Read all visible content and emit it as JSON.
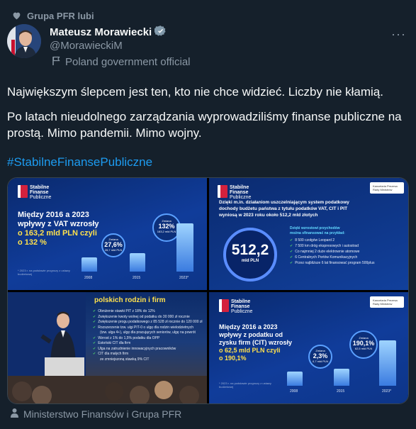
{
  "social_context": "Grupa PFR lubi",
  "author": {
    "name": "Mateusz Morawiecki",
    "handle": "@MorawieckiM",
    "affiliation": "Poland government official"
  },
  "tweet": {
    "line1": "Największym ślepcem jest ten, kto nie chce widzieć. Liczby nie kłamią.",
    "line2": "Po latach nieudolnego zarządzania wyprowadziliśmy finanse publiczne na prostą. Mimo pandemii. Mimo wojny.",
    "hashtag": "#StabilneFinansePubliczne"
  },
  "media": {
    "logo": [
      "Stabilne",
      "Finanse",
      "Publiczne"
    ],
    "kprm": "Kancelaria Prezesa Rady Ministrów",
    "panel1": {
      "heading_a": "Między 2016 a 2023",
      "heading_b": "wpływy z VAT wzrosły",
      "heading_c": "o 163,2 mld PLN czyli",
      "heading_d": "o 132 %",
      "bubble1_cap": "Zmiana",
      "bubble1_val": "27,6%",
      "bubble1_sub": "26,7 mld PLN",
      "bubble2_cap": "Zmiana",
      "bubble2_val": "132%",
      "bubble2_sub": "163,2 mld PLN",
      "years": [
        "2008",
        "2015",
        "2023*"
      ],
      "footnote": "* 2023 r. na podstawie prognozy z ustawy budżetowej"
    },
    "panel2": {
      "intro1": "Dzięki m.in. działaniom uszczelniającym system podatkowy",
      "intro2": "dochody budżetu państwa z tytułu podatków VAT, CIT i PIT",
      "intro3": "wyniosą w 2023 roku około 512,2 mld złotych",
      "circle_value": "512,2",
      "circle_unit": "mld PLN",
      "list_head1": "Dzięki wzrostowi przychodów",
      "list_head2": "można sfinansować na przykład:",
      "items": [
        "8 500 czołgów Leopard 2",
        "7 500 km dróg ekspresowych i autostrad",
        "Co najmniej 2 duże elektrownie atomowe",
        "6 Centralnych Portów Komunikacyjnych",
        "Przez najbliższe 6 lat finansować program 500plus"
      ]
    },
    "panel3": {
      "heading": "polskich rodzin i firm",
      "items": [
        "Obniżenie stawki PIT z 18% do 12%",
        "Zwiększenie kwoty wolnej od podatku do 30 000 zł rocznie",
        "Zwiększenie progu podatkowego z 85 528 zł rocznie do 120 000 zł",
        "Rozszerzenie tzw. ulgi PIT-0 o ulgę dla rodzin wielodzietnych",
        "(tzw. ulga 4+), ulgę dla pracujących seniorów, ulgę na powrót",
        "Wzrost z 1% do 1,5% podatku dla OPP",
        "Estoński CIT dla firm",
        "Ulga na zatrudnienie innowacyjnych pracowników",
        "CIT dla małych firm",
        "ze zmniejszoną stawką 9% CIT"
      ]
    },
    "panel4": {
      "heading_a": "Między 2016 a 2023",
      "heading_b": "wpływy z podatku od",
      "heading_c": "zysku firm (CIT) wzrosły",
      "heading_d": "o 62,5 mld PLN czyli",
      "heading_e": "o 190,1%",
      "bubble1_cap": "Zmiana",
      "bubble1_val": "2,3%",
      "bubble1_sub": "0,7 mld PLN",
      "bubble2_cap": "Zmiana",
      "bubble2_val": "190,1%",
      "bubble2_sub": "62,5 mld PLN",
      "years": [
        "2008",
        "2015",
        "2023*"
      ],
      "footnote": "* 2023 r. na podstawie prognozy z ustawy budżetowej"
    }
  },
  "footer": "Ministerstwo Finansów i Grupa PFR"
}
